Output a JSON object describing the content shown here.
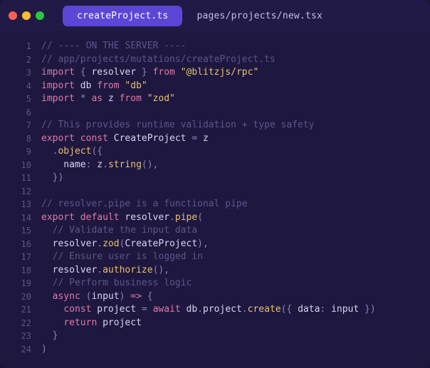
{
  "tabs": {
    "active": "createProject.ts",
    "inactive": "pages/projects/new.tsx"
  },
  "code": {
    "lines": [
      [
        {
          "t": "// ---- ON THE SERVER ----",
          "c": "c-com"
        }
      ],
      [
        {
          "t": "// app/projects/mutations/createProject.ts",
          "c": "c-com"
        }
      ],
      [
        {
          "t": "import ",
          "c": "c-key"
        },
        {
          "t": "{ ",
          "c": "c-pun"
        },
        {
          "t": "resolver ",
          "c": "c-id"
        },
        {
          "t": "} ",
          "c": "c-pun"
        },
        {
          "t": "from ",
          "c": "c-key"
        },
        {
          "t": "\"@blitzjs/rpc\"",
          "c": "c-str"
        }
      ],
      [
        {
          "t": "import ",
          "c": "c-key"
        },
        {
          "t": "db ",
          "c": "c-id"
        },
        {
          "t": "from ",
          "c": "c-key"
        },
        {
          "t": "\"db\"",
          "c": "c-str"
        }
      ],
      [
        {
          "t": "import ",
          "c": "c-key"
        },
        {
          "t": "* ",
          "c": "c-pun"
        },
        {
          "t": "as ",
          "c": "c-key"
        },
        {
          "t": "z ",
          "c": "c-id"
        },
        {
          "t": "from ",
          "c": "c-key"
        },
        {
          "t": "\"zod\"",
          "c": "c-str"
        }
      ],
      [],
      [
        {
          "t": "// This provides runtime validation + type safety",
          "c": "c-com"
        }
      ],
      [
        {
          "t": "export ",
          "c": "c-key"
        },
        {
          "t": "const ",
          "c": "c-key"
        },
        {
          "t": "CreateProject ",
          "c": "c-id"
        },
        {
          "t": "= ",
          "c": "c-pun"
        },
        {
          "t": "z",
          "c": "c-id"
        }
      ],
      [
        {
          "t": "  ",
          "c": ""
        },
        {
          "t": ".",
          "c": "c-pun"
        },
        {
          "t": "object",
          "c": "c-fn"
        },
        {
          "t": "({",
          "c": "c-pun"
        }
      ],
      [
        {
          "t": "    name",
          "c": "c-id"
        },
        {
          "t": ": ",
          "c": "c-pun"
        },
        {
          "t": "z",
          "c": "c-id"
        },
        {
          "t": ".",
          "c": "c-pun"
        },
        {
          "t": "string",
          "c": "c-fn"
        },
        {
          "t": "(),",
          "c": "c-pun"
        }
      ],
      [
        {
          "t": "  ",
          "c": ""
        },
        {
          "t": "})",
          "c": "c-pun"
        }
      ],
      [],
      [
        {
          "t": "// resolver.pipe is a functional pipe",
          "c": "c-com"
        }
      ],
      [
        {
          "t": "export ",
          "c": "c-key"
        },
        {
          "t": "default ",
          "c": "c-key"
        },
        {
          "t": "resolver",
          "c": "c-id"
        },
        {
          "t": ".",
          "c": "c-pun"
        },
        {
          "t": "pipe",
          "c": "c-fn"
        },
        {
          "t": "(",
          "c": "c-pun"
        }
      ],
      [
        {
          "t": "  ",
          "c": ""
        },
        {
          "t": "// Validate the input data",
          "c": "c-com"
        }
      ],
      [
        {
          "t": "  resolver",
          "c": "c-id"
        },
        {
          "t": ".",
          "c": "c-pun"
        },
        {
          "t": "zod",
          "c": "c-fn"
        },
        {
          "t": "(",
          "c": "c-pun"
        },
        {
          "t": "CreateProject",
          "c": "c-id"
        },
        {
          "t": "),",
          "c": "c-pun"
        }
      ],
      [
        {
          "t": "  ",
          "c": ""
        },
        {
          "t": "// Ensure user is logged in",
          "c": "c-com"
        }
      ],
      [
        {
          "t": "  resolver",
          "c": "c-id"
        },
        {
          "t": ".",
          "c": "c-pun"
        },
        {
          "t": "authorize",
          "c": "c-fn"
        },
        {
          "t": "(),",
          "c": "c-pun"
        }
      ],
      [
        {
          "t": "  ",
          "c": ""
        },
        {
          "t": "// Perform business logic",
          "c": "c-com"
        }
      ],
      [
        {
          "t": "  ",
          "c": ""
        },
        {
          "t": "async ",
          "c": "c-key"
        },
        {
          "t": "(",
          "c": "c-pun"
        },
        {
          "t": "input",
          "c": "c-id"
        },
        {
          "t": ") ",
          "c": "c-pun"
        },
        {
          "t": "=> ",
          "c": "c-key"
        },
        {
          "t": "{",
          "c": "c-pun"
        }
      ],
      [
        {
          "t": "    ",
          "c": ""
        },
        {
          "t": "const ",
          "c": "c-key"
        },
        {
          "t": "project ",
          "c": "c-id"
        },
        {
          "t": "= ",
          "c": "c-pun"
        },
        {
          "t": "await ",
          "c": "c-key"
        },
        {
          "t": "db",
          "c": "c-id"
        },
        {
          "t": ".",
          "c": "c-pun"
        },
        {
          "t": "project",
          "c": "c-id"
        },
        {
          "t": ".",
          "c": "c-pun"
        },
        {
          "t": "create",
          "c": "c-fn"
        },
        {
          "t": "({ ",
          "c": "c-pun"
        },
        {
          "t": "data",
          "c": "c-id"
        },
        {
          "t": ": ",
          "c": "c-pun"
        },
        {
          "t": "input ",
          "c": "c-id"
        },
        {
          "t": "})",
          "c": "c-pun"
        }
      ],
      [
        {
          "t": "    ",
          "c": ""
        },
        {
          "t": "return ",
          "c": "c-key"
        },
        {
          "t": "project",
          "c": "c-id"
        }
      ],
      [
        {
          "t": "  ",
          "c": ""
        },
        {
          "t": "}",
          "c": "c-pun"
        }
      ],
      [
        {
          "t": ")",
          "c": "c-pun"
        }
      ]
    ]
  }
}
